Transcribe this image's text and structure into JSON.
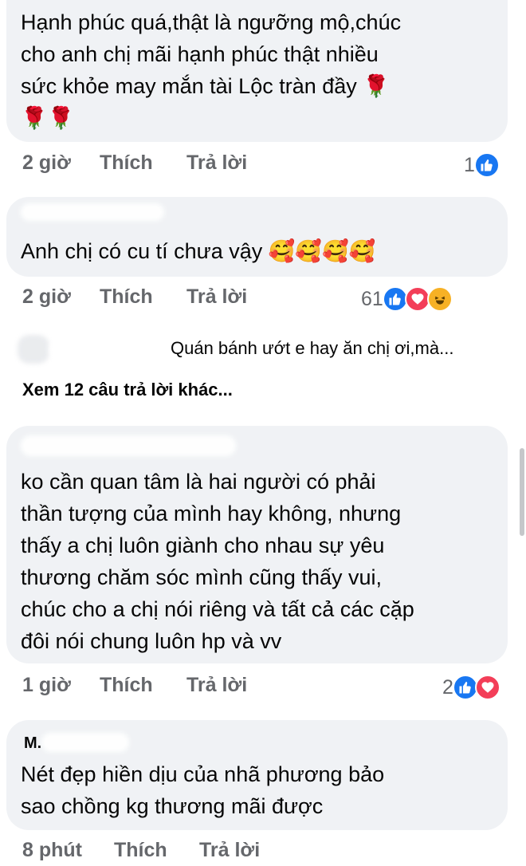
{
  "comments": [
    {
      "text": "Hạnh phúc quá,thật là ngưỡng mộ,chúc cho anh chị mãi hạnh phúc thật nhiều sức khỏe may mắn tài Lộc tràn đầy 🌹🌹🌹",
      "lines": [
        "Hạnh phúc quá,thật là ngưỡng mộ,chúc",
        "cho anh chị mãi hạnh phúc thật nhiều",
        "sức khỏe may mắn tài Lộc tràn đầy 🌹",
        "🌹🌹"
      ],
      "time": "2 giờ",
      "like": "Thích",
      "reply": "Trả lời",
      "reactions_count": "1",
      "reaction_icons": [
        "like-icon"
      ]
    },
    {
      "text": "Anh chị có cu tí chưa vậy 🥰🥰🥰🥰",
      "lines": [
        "Anh chị có cu tí chưa vậy 🥰🥰🥰🥰"
      ],
      "time": "2 giờ",
      "like": "Thích",
      "reply": "Trả lời",
      "reactions_count": "61",
      "reaction_icons": [
        "like-icon",
        "love-icon",
        "haha-icon"
      ]
    },
    {
      "text": "ko cần quan tâm là hai người có phải thần tượng của mình hay không, nhưng thấy a chị luôn giành cho nhau sự yêu thương chăm sóc mình cũng thấy vui, chúc cho a chị nói riêng và tất cả các cặp đôi nói chung luôn hp và vv",
      "lines": [
        "ko cần quan tâm là hai người có phải",
        "thần tượng của mình hay không, nhưng",
        "thấy a chị luôn giành cho nhau sự yêu",
        "thương chăm sóc mình cũng thấy vui,",
        "chúc cho a chị nói riêng và tất cả các cặp",
        "đôi nói chung luôn hp và vv"
      ],
      "time": "1 giờ",
      "like": "Thích",
      "reply": "Trả lời",
      "reactions_count": "2",
      "reaction_icons": [
        "like-icon",
        "love-icon"
      ]
    },
    {
      "author": "M.",
      "text": "Nét đẹp hiền dịu của nhã phương bảo sao chồng kg thương mãi được",
      "lines": [
        "Nét đẹp hiền dịu của nhã phương bảo",
        "sao chồng kg thương mãi được"
      ],
      "time": "8 phút",
      "like": "Thích",
      "reply": "Trả lời"
    }
  ],
  "reply_preview": "Quán bánh ướt e hay ăn chị ơi,mà...",
  "view_more": "Xem 12 câu trả lời khác...",
  "colors": {
    "bubble": "#f0f2f5",
    "meta": "#65676b",
    "like": "#1877f2",
    "love": "#f33e58",
    "haha": "#f7b125"
  }
}
